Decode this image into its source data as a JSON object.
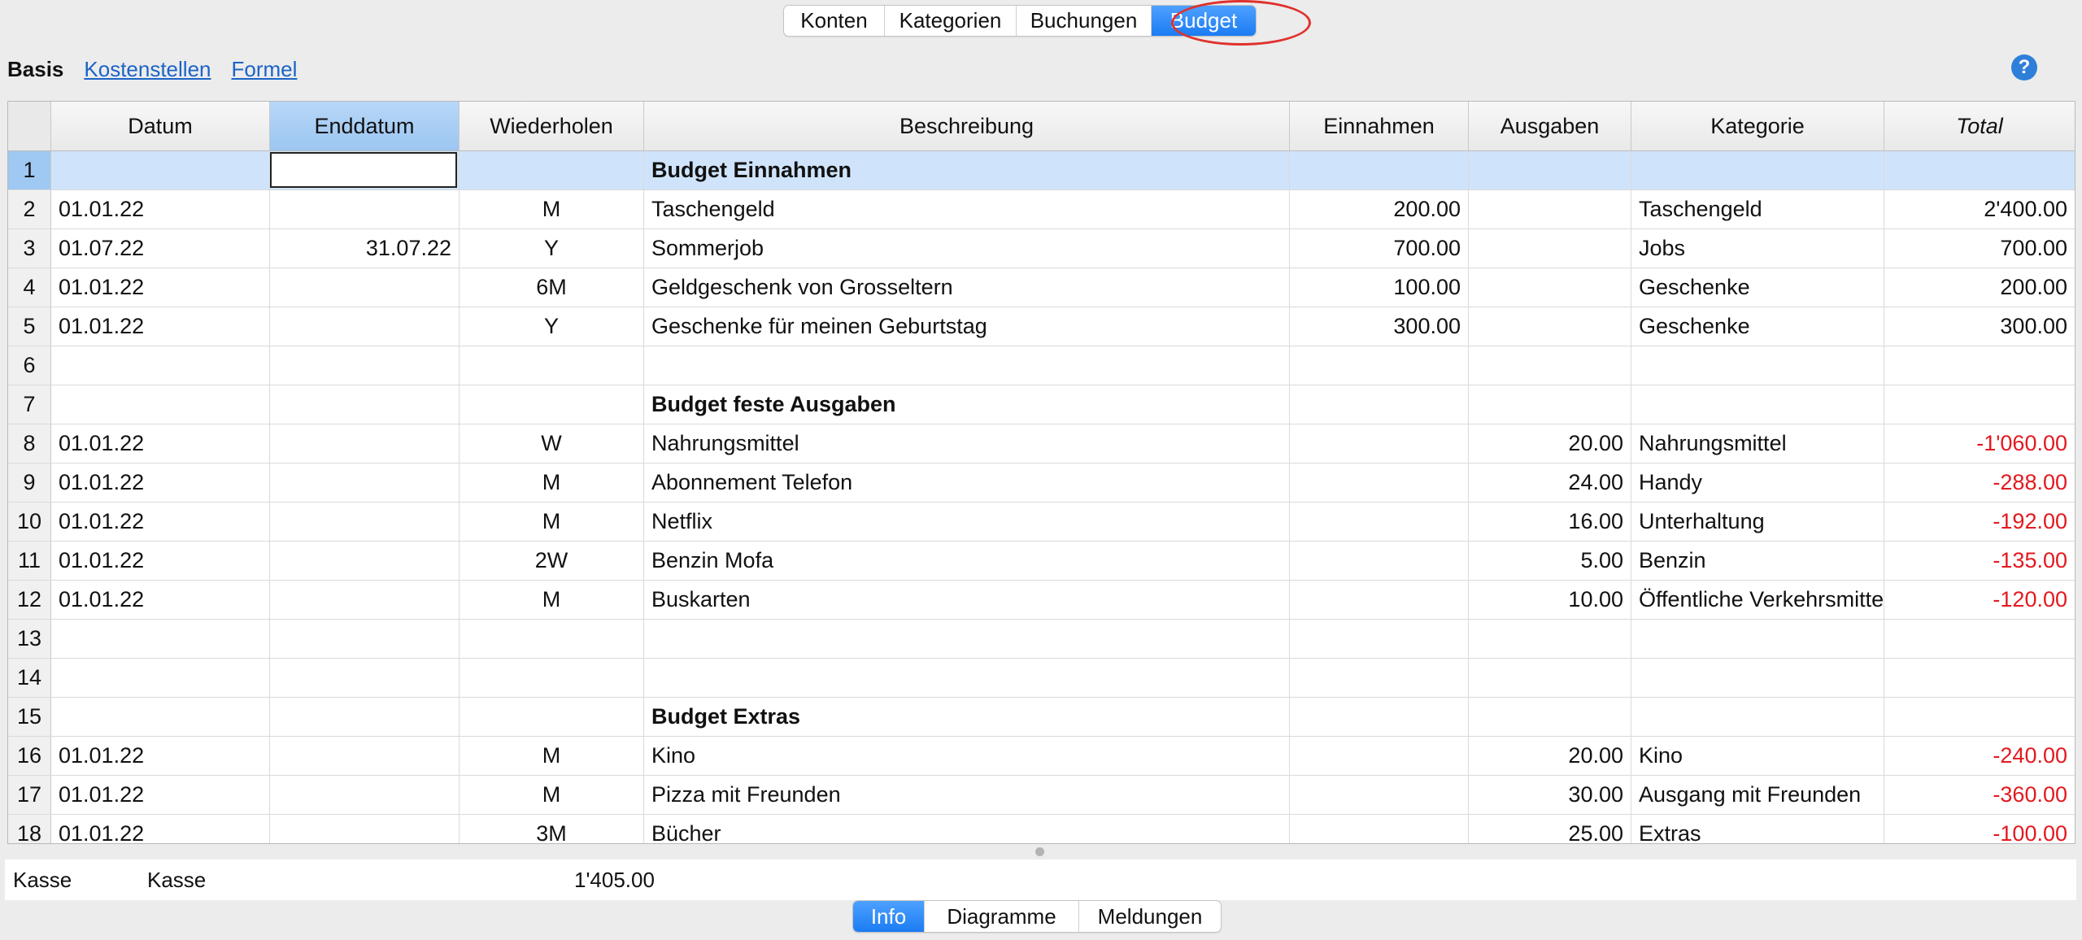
{
  "top_tabs": [
    {
      "label": "Konten"
    },
    {
      "label": "Kategorien"
    },
    {
      "label": "Buchungen"
    },
    {
      "label": "Budget",
      "active": true
    }
  ],
  "subnav": {
    "basis": "Basis",
    "kostenstellen": "Kostenstellen",
    "formel": "Formel"
  },
  "help": "?",
  "table": {
    "columns": [
      "Datum",
      "Enddatum",
      "Wiederholen",
      "Beschreibung",
      "Einnahmen",
      "Ausgaben",
      "Kategorie",
      "Total"
    ],
    "rows": [
      {
        "n": "1",
        "datum": "",
        "enddatum": "",
        "wiederholen": "",
        "beschreibung": "Budget Einnahmen",
        "einnahmen": "",
        "ausgaben": "",
        "kategorie": "",
        "total": ""
      },
      {
        "n": "2",
        "datum": "01.01.22",
        "enddatum": "",
        "wiederholen": "M",
        "beschreibung": "Taschengeld",
        "einnahmen": "200.00",
        "ausgaben": "",
        "kategorie": "Taschengeld",
        "total": "2'400.00"
      },
      {
        "n": "3",
        "datum": "01.07.22",
        "enddatum": "31.07.22",
        "wiederholen": "Y",
        "beschreibung": "Sommerjob",
        "einnahmen": "700.00",
        "ausgaben": "",
        "kategorie": "Jobs",
        "total": "700.00"
      },
      {
        "n": "4",
        "datum": "01.01.22",
        "enddatum": "",
        "wiederholen": "6M",
        "beschreibung": "Geldgeschenk von Grosseltern",
        "einnahmen": "100.00",
        "ausgaben": "",
        "kategorie": "Geschenke",
        "total": "200.00"
      },
      {
        "n": "5",
        "datum": "01.01.22",
        "enddatum": "",
        "wiederholen": "Y",
        "beschreibung": "Geschenke für meinen Geburtstag",
        "einnahmen": "300.00",
        "ausgaben": "",
        "kategorie": "Geschenke",
        "total": "300.00"
      },
      {
        "n": "6",
        "datum": "",
        "enddatum": "",
        "wiederholen": "",
        "beschreibung": "",
        "einnahmen": "",
        "ausgaben": "",
        "kategorie": "",
        "total": ""
      },
      {
        "n": "7",
        "datum": "",
        "enddatum": "",
        "wiederholen": "",
        "beschreibung": "Budget feste Ausgaben",
        "einnahmen": "",
        "ausgaben": "",
        "kategorie": "",
        "total": ""
      },
      {
        "n": "8",
        "datum": "01.01.22",
        "enddatum": "",
        "wiederholen": "W",
        "beschreibung": "Nahrungsmittel",
        "einnahmen": "",
        "ausgaben": "20.00",
        "kategorie": "Nahrungsmittel",
        "total": "-1'060.00"
      },
      {
        "n": "9",
        "datum": "01.01.22",
        "enddatum": "",
        "wiederholen": "M",
        "beschreibung": "Abonnement Telefon",
        "einnahmen": "",
        "ausgaben": "24.00",
        "kategorie": "Handy",
        "total": "-288.00"
      },
      {
        "n": "10",
        "datum": "01.01.22",
        "enddatum": "",
        "wiederholen": "M",
        "beschreibung": "Netflix",
        "einnahmen": "",
        "ausgaben": "16.00",
        "kategorie": "Unterhaltung",
        "total": "-192.00"
      },
      {
        "n": "11",
        "datum": "01.01.22",
        "enddatum": "",
        "wiederholen": "2W",
        "beschreibung": "Benzin Mofa",
        "einnahmen": "",
        "ausgaben": "5.00",
        "kategorie": "Benzin",
        "total": "-135.00"
      },
      {
        "n": "12",
        "datum": "01.01.22",
        "enddatum": "",
        "wiederholen": "M",
        "beschreibung": "Buskarten",
        "einnahmen": "",
        "ausgaben": "10.00",
        "kategorie": "Öffentliche Verkehrsmitte",
        "total": "-120.00"
      },
      {
        "n": "13",
        "datum": "",
        "enddatum": "",
        "wiederholen": "",
        "beschreibung": "",
        "einnahmen": "",
        "ausgaben": "",
        "kategorie": "",
        "total": ""
      },
      {
        "n": "14",
        "datum": "",
        "enddatum": "",
        "wiederholen": "",
        "beschreibung": "",
        "einnahmen": "",
        "ausgaben": "",
        "kategorie": "",
        "total": ""
      },
      {
        "n": "15",
        "datum": "",
        "enddatum": "",
        "wiederholen": "",
        "beschreibung": "Budget Extras",
        "einnahmen": "",
        "ausgaben": "",
        "kategorie": "",
        "total": ""
      },
      {
        "n": "16",
        "datum": "01.01.22",
        "enddatum": "",
        "wiederholen": "M",
        "beschreibung": "Kino",
        "einnahmen": "",
        "ausgaben": "20.00",
        "kategorie": "Kino",
        "total": "-240.00"
      },
      {
        "n": "17",
        "datum": "01.01.22",
        "enddatum": "",
        "wiederholen": "M",
        "beschreibung": "Pizza mit Freunden",
        "einnahmen": "",
        "ausgaben": "30.00",
        "kategorie": "Ausgang mit Freunden",
        "total": "-360.00"
      },
      {
        "n": "18",
        "datum": "01.01.22",
        "enddatum": "",
        "wiederholen": "3M",
        "beschreibung": "Bücher",
        "einnahmen": "",
        "ausgaben": "25.00",
        "kategorie": "Extras",
        "total": "-100.00"
      }
    ]
  },
  "info_bar": {
    "account": "Kasse",
    "description": "Kasse",
    "amount": "1'405.00"
  },
  "bottom_tabs": [
    {
      "label": "Info",
      "active": true
    },
    {
      "label": "Diagramme"
    },
    {
      "label": "Meldungen"
    }
  ],
  "colors": {
    "accent": "#1b7cf2",
    "negative": "#e3191f",
    "selection": "#cfe4fb",
    "highlight_oval": "#e0312d"
  }
}
